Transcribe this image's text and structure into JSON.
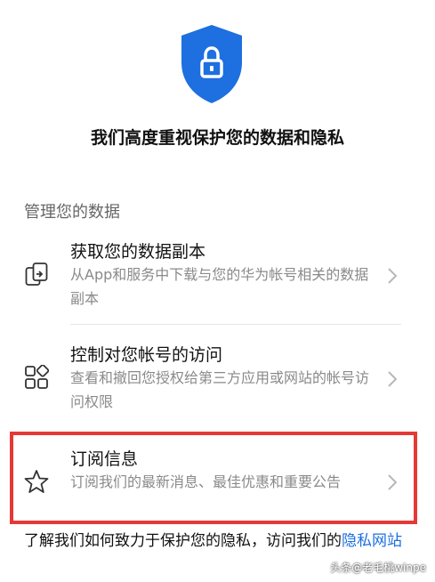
{
  "header": {
    "shield_icon": "shield-lock-icon",
    "title": "我们高度重视保护您的数据和隐私"
  },
  "section": {
    "title": "管理您的数据"
  },
  "items": [
    {
      "icon": "data-copy-icon",
      "title": "获取您的数据副本",
      "desc": "从App和服务中下载与您的华为帐号相关的数据副本"
    },
    {
      "icon": "app-grid-icon",
      "title": "控制对您帐号的访问",
      "desc": "查看和撤回您授权给第三方应用或网站的帐号访问权限"
    },
    {
      "icon": "star-icon",
      "title": "订阅信息",
      "desc": "订阅我们的最新消息、最佳优惠和重要公告"
    }
  ],
  "footer": {
    "text": "了解我们如何致力于保护您的隐私，访问我们的",
    "link": "隐私网站"
  },
  "watermark": "头条@老毛桃winpe",
  "colors": {
    "accent": "#1e6fe0",
    "highlight": "#e53935"
  }
}
